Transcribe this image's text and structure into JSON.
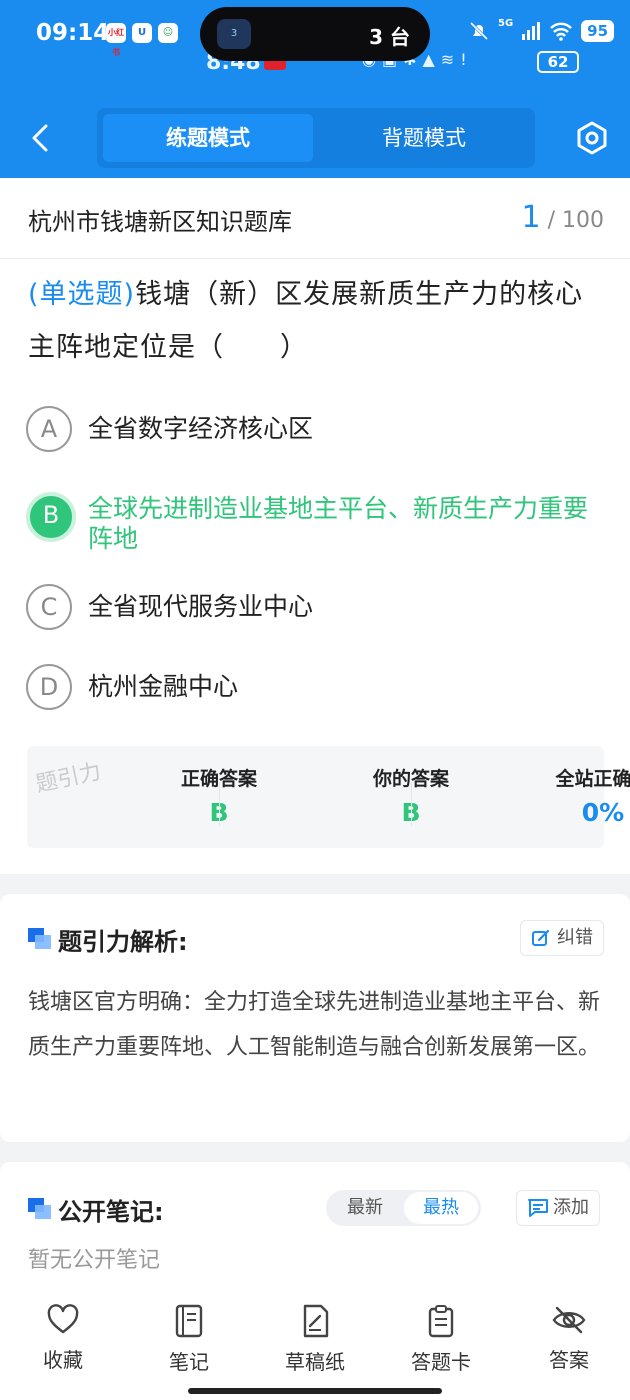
{
  "status_bar": {
    "time": "09:14",
    "mini_icons": [
      "小红书",
      "U",
      "☺"
    ],
    "island_text": "3 台",
    "island_app": "3",
    "signal": "5G",
    "battery": "95",
    "ghost_time": "8:48",
    "ghost_battery": "62"
  },
  "header": {
    "mode_practice": "练题模式",
    "mode_memorize": "背题模式"
  },
  "question_card": {
    "bank_title": "杭州市钱塘新区知识题库",
    "current": "1",
    "total": "/ 100",
    "type_label": "(单选题)",
    "question_text": "钱塘（新）区发展新质生产力的核心主阵地定位是（　　）",
    "options": [
      {
        "letter": "A",
        "text": "全省数字经济核心区"
      },
      {
        "letter": "B",
        "text": "全球先进制造业基地主平台、新质生产力重要阵地"
      },
      {
        "letter": "C",
        "text": "全省现代服务业中心"
      },
      {
        "letter": "D",
        "text": "杭州金融中心"
      }
    ],
    "answers": {
      "correct_label": "正确答案",
      "correct_value": "B",
      "yours_label": "你的答案",
      "yours_value": "B",
      "rate_label": "全站正确率",
      "rate_value": "0%"
    },
    "watermark": "题引力"
  },
  "analysis": {
    "title": "题引力解析:",
    "report_label": "纠错",
    "text": "钱塘区官方明确：全力打造全球先进制造业基地主平台、新质生产力重要阵地、人工智能制造与融合创新发展第一区。"
  },
  "notes": {
    "title": "公开笔记:",
    "sort_newest": "最新",
    "sort_hottest": "最热",
    "add_label": "添加",
    "empty_text": "暂无公开笔记"
  },
  "bottom_nav": {
    "favorite": "收藏",
    "notes": "笔记",
    "draft": "草稿纸",
    "answer_sheet": "答题卡",
    "answer": "答案"
  },
  "colors": {
    "primary": "#1a8cf0",
    "correct": "#2fc57a"
  }
}
